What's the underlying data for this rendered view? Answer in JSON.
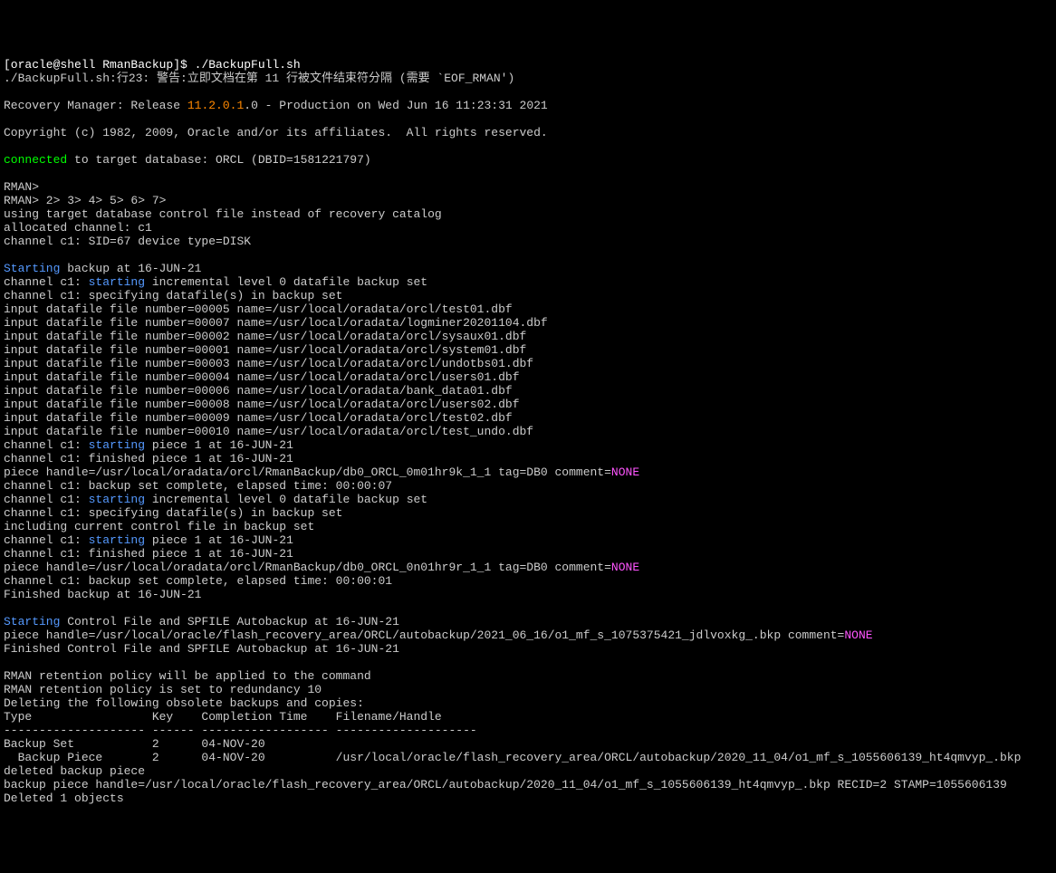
{
  "prompt": "[oracle@shell RmanBackup]$ ",
  "cmd": "./BackupFull.sh",
  "warn": "./BackupFull.sh:行23: 警告:立即文档在第 11 行被文件结束符分隔 (需要 `EOF_RMAN')",
  "rm_pre": "Recovery Manager: Release ",
  "rm_ver": "11.2.0.1",
  "rm_post": ".0 - Production on Wed Jun 16 11:23:31 2021",
  "copyright": "Copyright (c) 1982, 2009, Oracle and/or its affiliates.  All rights reserved.",
  "connected": "connected",
  "conn_post": " to target database: ORCL (DBID=1581221797)",
  "rman1": "RMAN>",
  "rman2": "RMAN> 2> 3> 4> 5> 6> 7>",
  "using": "using target database control file instead of recovery catalog",
  "alloc": "allocated channel: c1",
  "chan_sid": "channel c1: SID=67 device type=DISK",
  "starting": "Starting",
  "start_backup": " backup at 16-JUN-21",
  "ch_pre": "channel c1: ",
  "starting_w": "starting",
  "inc0": " incremental level 0 datafile backup set",
  "spec": "channel c1: specifying datafile(s) in backup set",
  "df": [
    "input datafile file number=00005 name=/usr/local/oradata/orcl/test01.dbf",
    "input datafile file number=00007 name=/usr/local/oradata/logminer20201104.dbf",
    "input datafile file number=00002 name=/usr/local/oradata/orcl/sysaux01.dbf",
    "input datafile file number=00001 name=/usr/local/oradata/orcl/system01.dbf",
    "input datafile file number=00003 name=/usr/local/oradata/orcl/undotbs01.dbf",
    "input datafile file number=00004 name=/usr/local/oradata/orcl/users01.dbf",
    "input datafile file number=00006 name=/usr/local/oradata/bank_data01.dbf",
    "input datafile file number=00008 name=/usr/local/oradata/orcl/users02.dbf",
    "input datafile file number=00009 name=/usr/local/oradata/orcl/test02.dbf",
    "input datafile file number=00010 name=/usr/local/oradata/orcl/test_undo.dbf"
  ],
  "piece1_at": " piece 1 at 16-JUN-21",
  "fin_piece": "channel c1: finished piece 1 at 16-JUN-21",
  "ph1_pre": "piece handle=/usr/local/oradata/orcl/RmanBackup/db0_ORCL_0m01hr9k_1_1 tag=DB0 comment=",
  "none": "NONE",
  "elapsed07": "channel c1: backup set complete, elapsed time: 00:00:07",
  "incl_ctrl": "including current control file in backup set",
  "ph2_pre": "piece handle=/usr/local/oradata/orcl/RmanBackup/db0_ORCL_0n01hr9r_1_1 tag=DB0 comment=",
  "elapsed01": "channel c1: backup set complete, elapsed time: 00:00:01",
  "fin_backup": "Finished backup at 16-JUN-21",
  "start_spfile": " Control File and SPFILE Autobackup at 16-JUN-21",
  "ph3_pre": "piece handle=/usr/local/oracle/flash_recovery_area/ORCL/autobackup/2021_06_16/o1_mf_s_1075375421_jdlvoxkg_.bkp comment=",
  "fin_spfile": "Finished Control File and SPFILE Autobackup at 16-JUN-21",
  "ret1": "RMAN retention policy will be applied to the command",
  "ret2": "RMAN retention policy is set to redundancy 10",
  "del": "Deleting the following obsolete backups and copies:",
  "hdr": "Type                 Key    Completion Time    Filename/Handle",
  "sep": "-------------------- ------ ------------------ --------------------",
  "row1": "Backup Set           2      04-NOV-20",
  "row2": "  Backup Piece       2      04-NOV-20          /usr/local/oracle/flash_recovery_area/ORCL/autobackup/2020_11_04/o1_mf_s_1055606139_ht4qmvyp_.bkp",
  "delbp": "deleted backup piece",
  "bph": "backup piece handle=/usr/local/oracle/flash_recovery_area/ORCL/autobackup/2020_11_04/o1_mf_s_1055606139_ht4qmvyp_.bkp RECID=2 STAMP=1055606139",
  "del1": "Deleted 1 objects"
}
